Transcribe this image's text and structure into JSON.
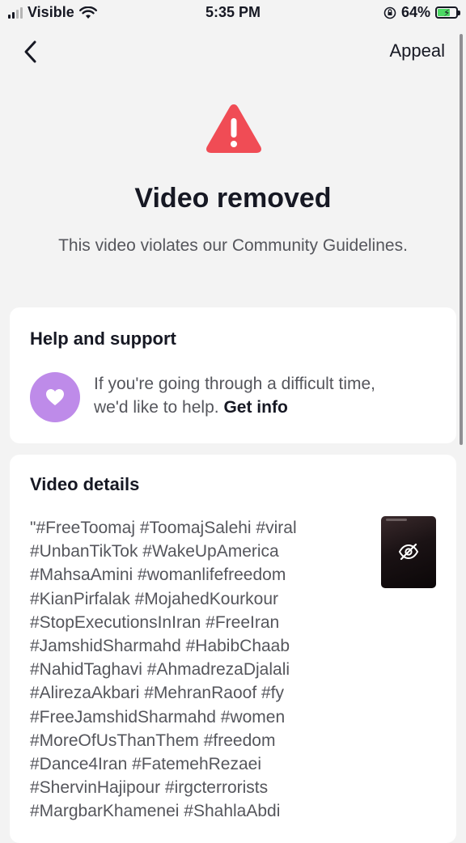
{
  "status_bar": {
    "carrier": "Visible",
    "time": "5:35 PM",
    "battery_percent": "64%",
    "icons": [
      "signal-bars",
      "wifi-icon",
      "orientation-lock-icon",
      "battery-charging-icon"
    ]
  },
  "nav": {
    "back_icon": "chevron-left-icon",
    "appeal_label": "Appeal"
  },
  "notice": {
    "icon": "warning-triangle-icon",
    "title": "Video removed",
    "subtitle": "This video violates our Community Guidelines."
  },
  "help": {
    "title": "Help and support",
    "icon": "heart-icon",
    "text": "If you're going through a difficult time, we'd like to help.",
    "text_line1": "If you're going through a difficult time,",
    "text_line2": "we'd like to help.",
    "link_label": "Get info"
  },
  "details": {
    "title": "Video details",
    "thumbnail_icon": "eye-slash-icon",
    "description_lines": [
      "\"#FreeToomaj #ToomajSalehi #viral",
      "#UnbanTikTok #WakeUpAmerica",
      "#MahsaAmini #womanlifefreedom",
      "#KianPirfalak #MojahedKourkour",
      "#StopExecutionsInIran #FreeIran",
      "#JamshidSharmahd #HabibChaab",
      "#NahidTaghavi #AhmadrezaDjalali",
      "#AlirezaAkbari #MehranRaoof #fy",
      "#FreeJamshidSharmahd #women",
      "#MoreOfUsThanThem #freedom",
      "#Dance4Iran #FatemehRezaei",
      "#ShervinHajipour #irgcterrorists",
      "#MargbarKhamenei #ShahlaAbdi"
    ]
  },
  "colors": {
    "warning_red": "#fe2c55",
    "heart_purple": "#be8be9",
    "background": "#f3f3f3",
    "card": "#ffffff"
  }
}
